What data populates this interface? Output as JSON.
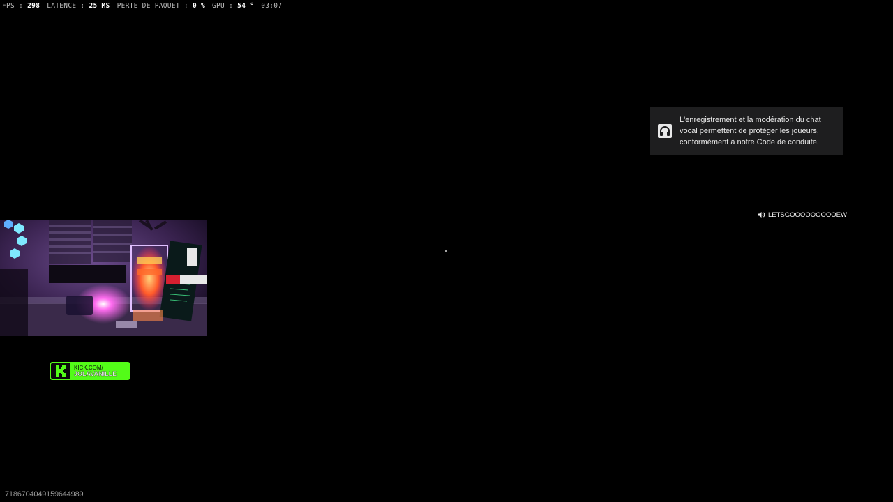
{
  "perf_hud": {
    "fps_label": "FPS",
    "fps_value": "298",
    "latency_label": "LATENCE",
    "latency_value": "25 MS",
    "packet_loss_label": "PERTE DE PAQUET",
    "packet_loss_value": "0 %",
    "gpu_label": "GPU",
    "gpu_value": "54 °",
    "clock": "03:07",
    "separator": ":"
  },
  "voice_notice": {
    "icon": "headset-icon",
    "message": "L'enregistrement et la modération du chat vocal permettent de protéger les joueurs, conformément à notre Code de conduite."
  },
  "speaking": {
    "icon": "speaker-icon",
    "player_name": "LETSGOOOOOOOOOEW"
  },
  "kick_badge": {
    "line1": "KICK.COM/",
    "line2": "JOLAVANILLE",
    "icon": "kick-logo-icon",
    "brand_color": "#53fc18"
  },
  "session_id": "718670404915964498​9",
  "session_id_text": "7186704049159644989"
}
